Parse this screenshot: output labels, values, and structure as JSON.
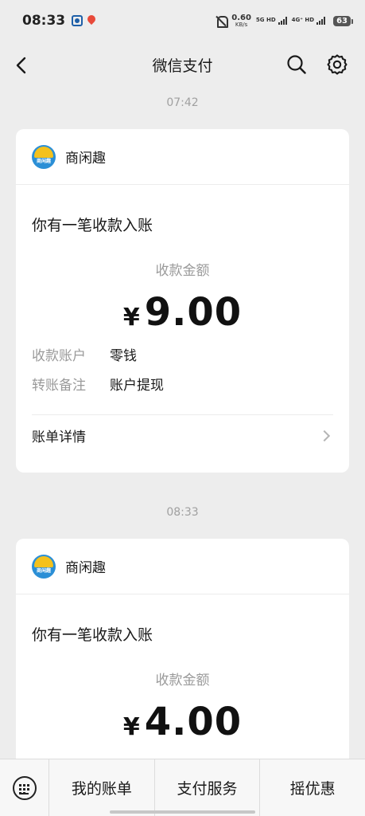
{
  "status_bar": {
    "time": "08:33",
    "net_speed_value": "0.60",
    "net_speed_unit": "KB/s",
    "sim1_label": "5G HD",
    "sim2_label": "4G⁺ HD",
    "battery": "63"
  },
  "header": {
    "title": "微信支付"
  },
  "messages": [
    {
      "timestamp": "07:42",
      "merchant_name": "商闲趣",
      "logo_text": "商闲趣",
      "notice": "你有一笔收款入账",
      "amount_label": "收款金额",
      "currency": "¥",
      "amount": "9.00",
      "details": [
        {
          "key": "收款账户",
          "value": "零钱"
        },
        {
          "key": "转账备注",
          "value": "账户提现"
        }
      ],
      "link_label": "账单详情"
    },
    {
      "timestamp": "08:33",
      "merchant_name": "商闲趣",
      "logo_text": "商闲趣",
      "notice": "你有一笔收款入账",
      "amount_label": "收款金额",
      "currency": "¥",
      "amount": "4.00"
    }
  ],
  "bottom_menu": {
    "items": [
      {
        "label": "我的账单"
      },
      {
        "label": "支付服务"
      },
      {
        "label": "摇优惠"
      }
    ]
  },
  "colors": {
    "background": "#ededed",
    "card": "#ffffff",
    "muted_text": "#9a9a9a"
  }
}
